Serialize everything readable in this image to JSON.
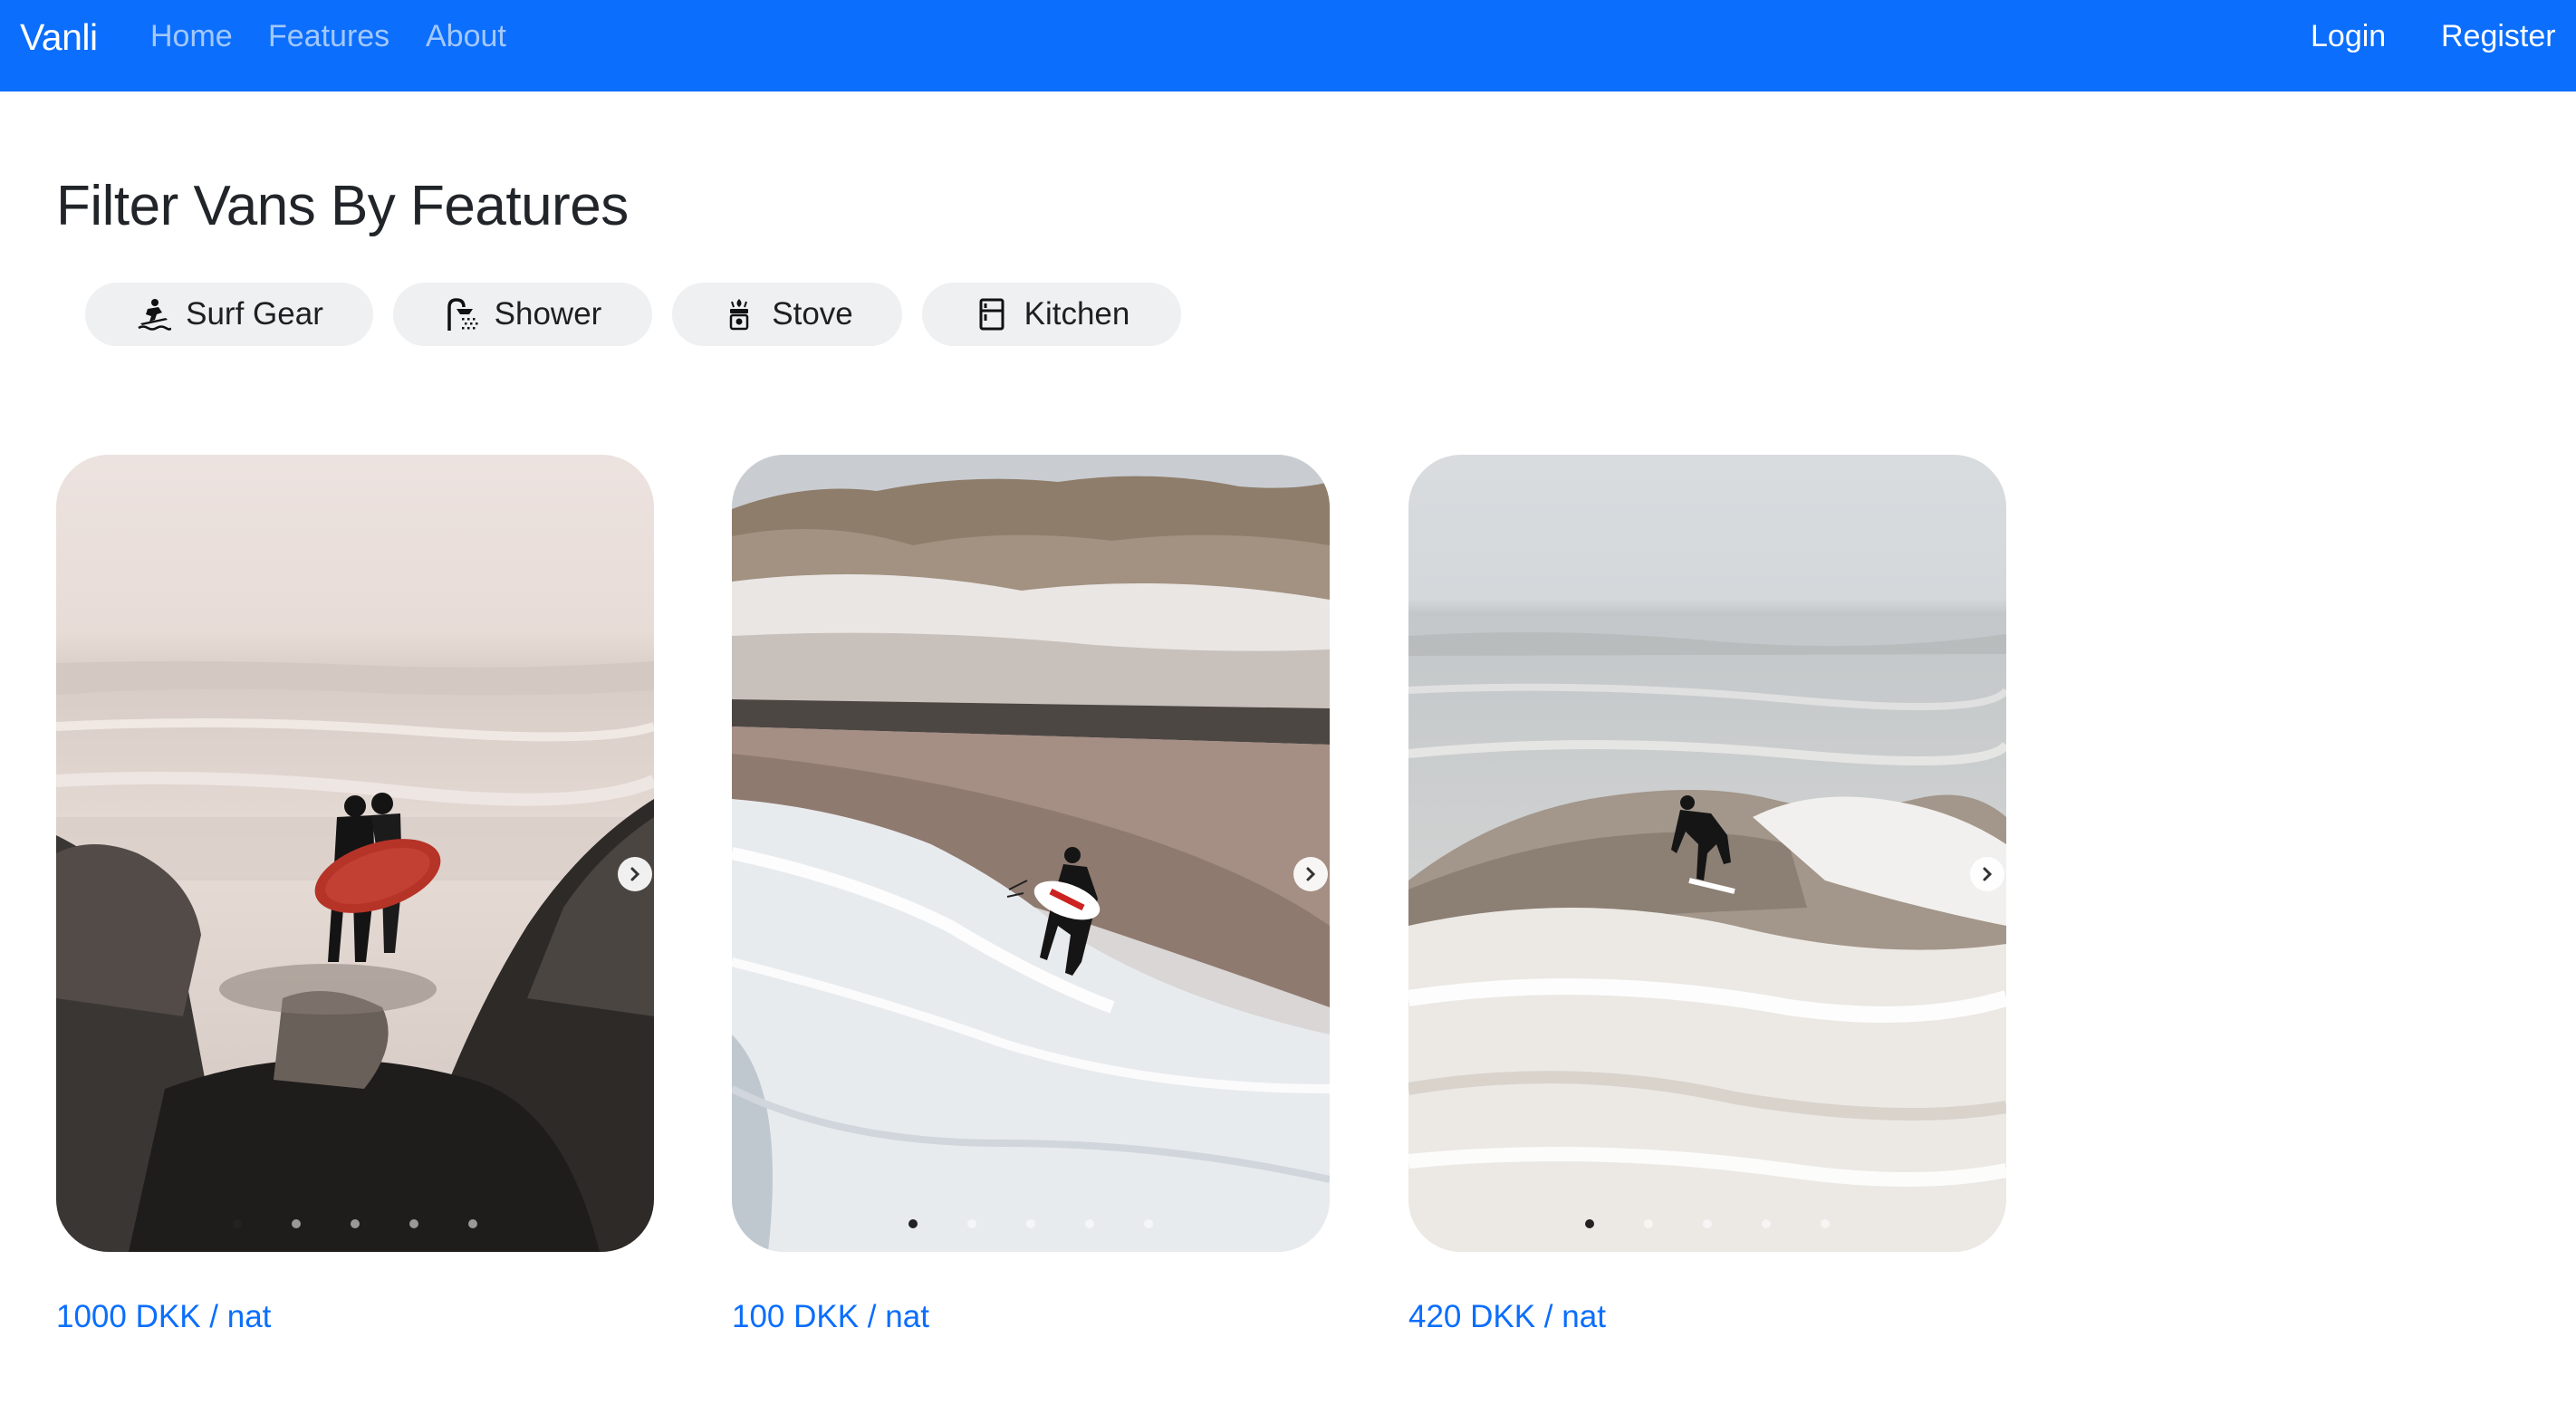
{
  "navbar": {
    "brand": "Vanli",
    "links": [
      {
        "label": "Home"
      },
      {
        "label": "Features"
      },
      {
        "label": "About"
      }
    ],
    "right_links": [
      {
        "label": "Login"
      },
      {
        "label": "Register"
      }
    ],
    "bg_color": "#0b6efd"
  },
  "main": {
    "title": "Filter Vans By Features",
    "filters": [
      {
        "label": "Surf Gear",
        "icon": "surfer-icon"
      },
      {
        "label": "Shower",
        "icon": "shower-icon"
      },
      {
        "label": "Stove",
        "icon": "stove-icon"
      },
      {
        "label": "Kitchen",
        "icon": "kitchen-icon"
      }
    ],
    "listings": [
      {
        "price": "1000 DKK / nat",
        "image": "surfers-carrying-red-board-between-rocks",
        "slides": 5,
        "active_slide": 1
      },
      {
        "price": "100 DKK / nat",
        "image": "surfer-running-into-waves-on-beach",
        "slides": 5,
        "active_slide": 1
      },
      {
        "price": "420 DKK / nat",
        "image": "surfer-riding-wave",
        "slides": 5,
        "active_slide": 1
      }
    ]
  },
  "colors": {
    "accent": "#0b6efd",
    "pill_bg": "#eff0f2",
    "text": "#212529"
  }
}
